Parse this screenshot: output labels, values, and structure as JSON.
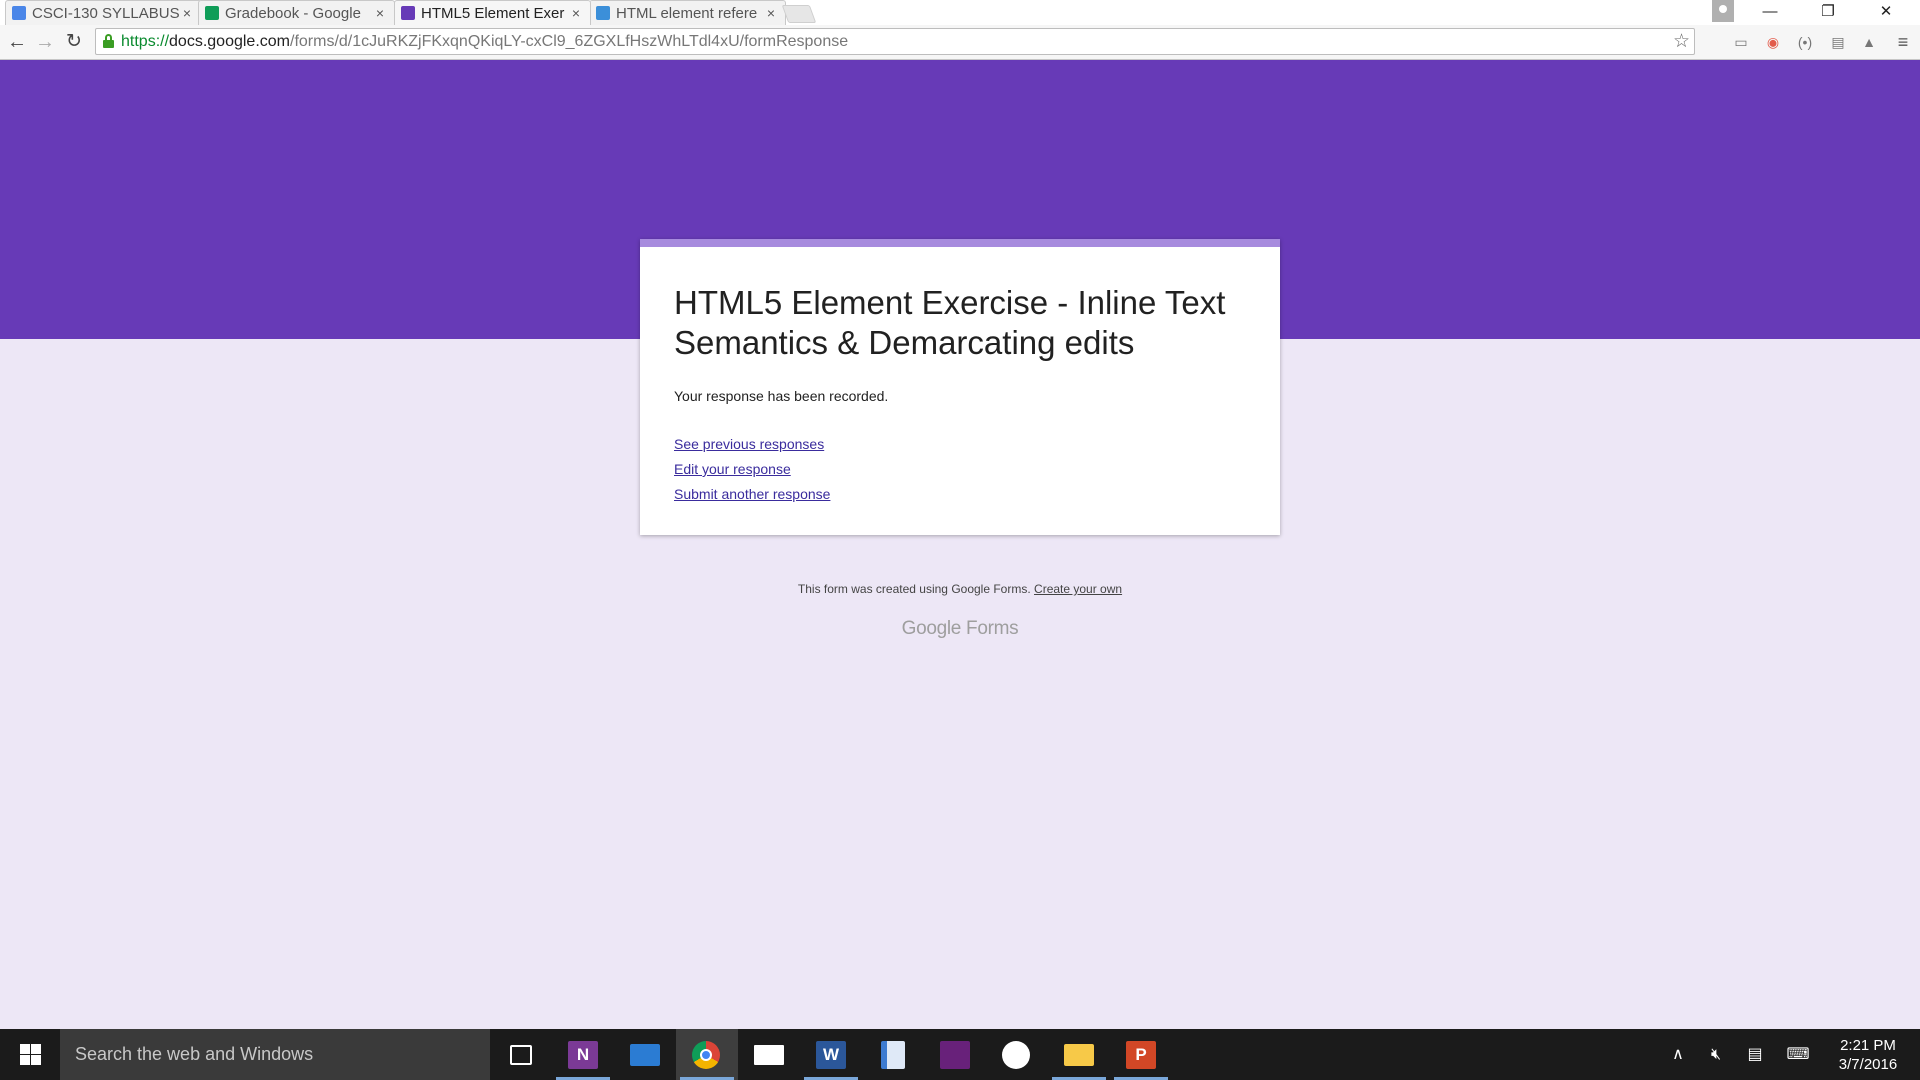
{
  "browser": {
    "tabs": [
      {
        "label": "CSCI-130 SYLLABUS",
        "favicon_color": "#4a86e8",
        "active": false
      },
      {
        "label": "Gradebook - Google",
        "favicon_color": "#0f9d58",
        "active": false
      },
      {
        "label": "HTML5 Element Exer",
        "favicon_color": "#673ab7",
        "active": true
      },
      {
        "label": "HTML element refere",
        "favicon_color": "#3b8fd9",
        "active": false
      }
    ],
    "tab_close_glyph": "×",
    "window_controls": {
      "minimize": "—",
      "restore": "❐",
      "close": "✕"
    },
    "url": {
      "scheme": "https://",
      "host": "docs.google.com",
      "path": "/forms/d/1cJuRKZjFKxqnQKiqLY-cxCl9_6ZGXLfHszWhLTdl4xU/formResponse"
    }
  },
  "form": {
    "accent_color": "#673ab7",
    "title": "HTML5 Element Exercise - Inline Text Semantics & Demarcating edits",
    "confirmation": "Your response has been recorded.",
    "links": [
      {
        "label": "See previous responses"
      },
      {
        "label": "Edit your response"
      },
      {
        "label": "Submit another response"
      }
    ],
    "footer_text": "This form was created using Google Forms.",
    "footer_link": "Create your own",
    "logo_text": "Google Forms"
  },
  "taskbar": {
    "search_placeholder": "Search the web and Windows",
    "apps": [
      {
        "name": "task-view",
        "icon": "task-view-icon"
      },
      {
        "name": "onenote",
        "icon": "onenote-icon",
        "glyph": "N",
        "color": "#7b3a96"
      },
      {
        "name": "remote-desktop",
        "icon": "remote-desktop-icon",
        "color": "#2b7cd3"
      },
      {
        "name": "chrome",
        "icon": "chrome-icon",
        "active": true
      },
      {
        "name": "mail",
        "icon": "mail-icon"
      },
      {
        "name": "word",
        "icon": "word-icon",
        "glyph": "W",
        "color": "#2b579a"
      },
      {
        "name": "file-notepad",
        "icon": "document-icon",
        "color": "#3d7bd1"
      },
      {
        "name": "visual-studio",
        "icon": "visual-studio-icon",
        "color": "#68217a"
      },
      {
        "name": "github",
        "icon": "github-icon"
      },
      {
        "name": "file-explorer",
        "icon": "folder-icon",
        "color": "#f7c948"
      },
      {
        "name": "powerpoint",
        "icon": "powerpoint-icon",
        "glyph": "P",
        "color": "#d24726"
      }
    ],
    "clock_time": "2:21 PM",
    "clock_date": "3/7/2016"
  }
}
